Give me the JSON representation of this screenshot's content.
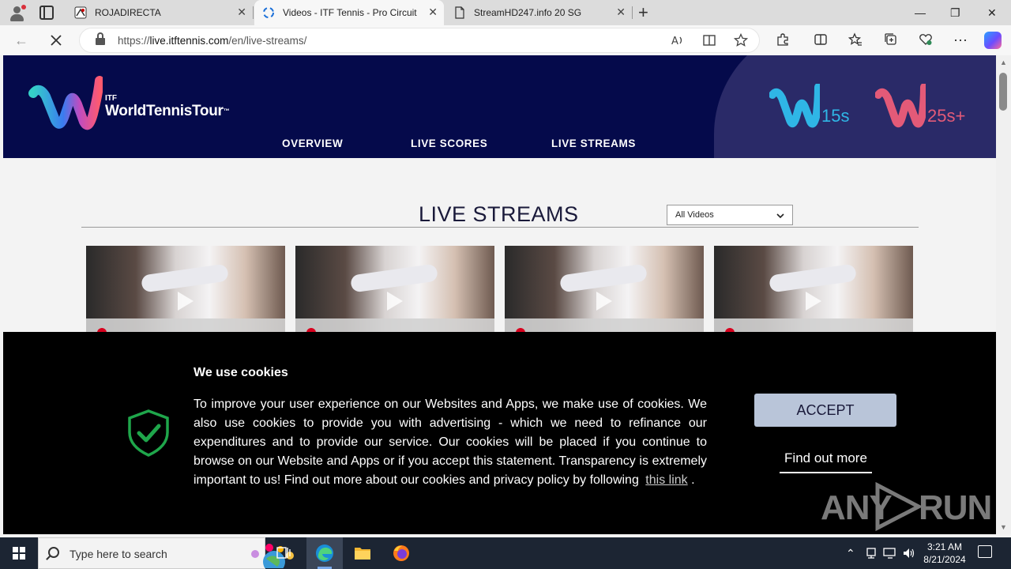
{
  "browser": {
    "tabs": [
      {
        "title": "ROJADIRECTA",
        "close": "✕"
      },
      {
        "title": "Videos - ITF Tennis - Pro Circuit",
        "close": "✕"
      },
      {
        "title": "StreamHD247.info 20 SG",
        "close": "✕"
      }
    ],
    "new_tab": "+",
    "window_controls": {
      "minimize": "—",
      "maximize": "❐",
      "close": "✕"
    },
    "url_prefix": "https://",
    "url_domain": "live.itftennis.com",
    "url_path": "/en/live-streams/"
  },
  "site": {
    "logo": {
      "itf": "ITF",
      "brand": "WorldTennisTour",
      "tm": "™"
    },
    "nav": [
      "OVERVIEW",
      "LIVE SCORES",
      "LIVE STREAMS"
    ],
    "tiers": [
      "15s",
      "25s+"
    ],
    "section_title": "LIVE STREAMS",
    "filter": {
      "selected": "All Videos"
    },
    "video_count": 4
  },
  "cookie": {
    "title": "We use cookies",
    "body": "To improve your user experience on our Websites and Apps, we make use of cookies. We also use cookies to provide you with advertising - which we need to refinance our expenditures and to provide our service. Our cookies will be placed if you continue to browse on our Website and Apps or if you accept this statement. Transparency is extremely important to us! Find out more about our cookies and privacy policy by following",
    "link": "this link",
    "period": ".",
    "accept": "ACCEPT",
    "find_out_more": "Find out more"
  },
  "watermark": {
    "left": "ANY",
    "right": "RUN"
  },
  "taskbar": {
    "search_placeholder": "Type here to search",
    "time": "3:21 AM",
    "date": "8/21/2024"
  },
  "colors": {
    "header_bg": "#050a4b",
    "accept_bg": "#b9c5d9",
    "shield_green": "#1fa64b",
    "tier_15": "#2fb6e6",
    "tier_25": "#e35a78"
  }
}
